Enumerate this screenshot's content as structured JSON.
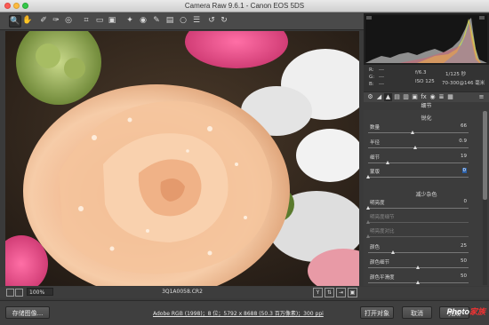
{
  "window": {
    "title": "Camera Raw 9.6.1 -  Canon EOS 5DS"
  },
  "toolbar": {
    "tools": [
      "zoom-icon",
      "hand-icon",
      "white-balance-icon",
      "color-sampler-icon",
      "target-adjust-icon",
      "crop-icon",
      "straighten-icon",
      "transform-icon",
      "spot-removal-icon",
      "red-eye-icon",
      "adjustment-brush-icon",
      "graduated-filter-icon",
      "radial-filter-icon",
      "preferences-icon",
      "rotate-left-icon",
      "rotate-right-icon"
    ]
  },
  "info": {
    "r": "R:",
    "g": "G:",
    "b": "B:",
    "r_val": "---",
    "g_val": "---",
    "b_val": "---",
    "aperture": "f/6.3",
    "shutter": "1/125 秒",
    "iso": "ISO 125",
    "lens": "70-300@146 毫米"
  },
  "panel": {
    "section_title": "细节",
    "sharpen": {
      "title": "锐化",
      "sliders": [
        {
          "label": "数量",
          "value": "66",
          "fraction": 0.44
        },
        {
          "label": "半径",
          "value": "0.9",
          "fraction": 0.47
        },
        {
          "label": "细节",
          "value": "19",
          "fraction": 0.19
        },
        {
          "label": "蒙版",
          "value": "0",
          "fraction": 0.0
        }
      ]
    },
    "noise": {
      "title": "减少杂色",
      "sliders": [
        {
          "label": "明亮度",
          "value": "0",
          "fraction": 0.0,
          "dim": false
        },
        {
          "label": "明亮度细节",
          "value": "",
          "fraction": 0.0,
          "dim": true
        },
        {
          "label": "明亮度对比",
          "value": "",
          "fraction": 0.0,
          "dim": true
        },
        {
          "label": "颜色",
          "value": "25",
          "fraction": 0.25,
          "dim": false
        },
        {
          "label": "颜色细节",
          "value": "50",
          "fraction": 0.5,
          "dim": false
        },
        {
          "label": "颜色平滑度",
          "value": "50",
          "fraction": 0.5,
          "dim": false
        }
      ]
    }
  },
  "previewbar": {
    "zoom": "100%",
    "filename": "3Q1A0058.CR2"
  },
  "bottom": {
    "save_label": "存储图像...",
    "workflow_link": "Adobe RGB (1998)；8 位；5792 x 8688 (50.3 百万像素)；300 ppi",
    "open_label": "打开对象",
    "cancel_label": "取消",
    "done_label": "完成"
  },
  "watermark": {
    "main": "Photo",
    "accent": "家族"
  }
}
